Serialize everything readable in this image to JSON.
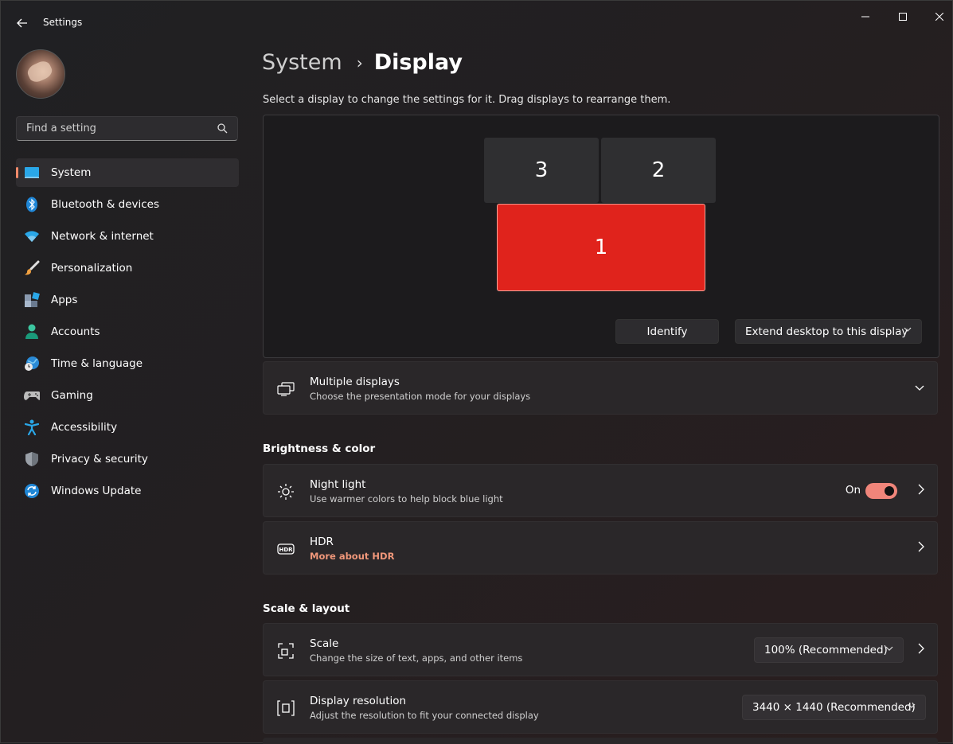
{
  "app": {
    "title": "Settings"
  },
  "search": {
    "placeholder": "Find a setting"
  },
  "sidebar": {
    "items": [
      {
        "label": "System"
      },
      {
        "label": "Bluetooth & devices"
      },
      {
        "label": "Network & internet"
      },
      {
        "label": "Personalization"
      },
      {
        "label": "Apps"
      },
      {
        "label": "Accounts"
      },
      {
        "label": "Time & language"
      },
      {
        "label": "Gaming"
      },
      {
        "label": "Accessibility"
      },
      {
        "label": "Privacy & security"
      },
      {
        "label": "Windows Update"
      }
    ]
  },
  "breadcrumb": {
    "parent": "System",
    "separator": "›",
    "current": "Display"
  },
  "main": {
    "subtitle": "Select a display to change the settings for it. Drag displays to rearrange them.",
    "monitors": {
      "m1": "1",
      "m2": "2",
      "m3": "3"
    },
    "identify_label": "Identify",
    "extend_label": "Extend desktop to this display",
    "multiple_displays": {
      "title": "Multiple displays",
      "desc": "Choose the presentation mode for your displays"
    },
    "brightness_section": "Brightness & color",
    "night_light": {
      "title": "Night light",
      "desc": "Use warmer colors to help block blue light",
      "state": "On"
    },
    "hdr": {
      "title": "HDR",
      "link": "More about HDR"
    },
    "scale_section": "Scale & layout",
    "scale": {
      "title": "Scale",
      "desc": "Change the size of text, apps, and other items",
      "value": "100% (Recommended)"
    },
    "resolution": {
      "title": "Display resolution",
      "desc": "Adjust the resolution to fit your connected display",
      "value": "3440 × 1440 (Recommended)"
    }
  },
  "colors": {
    "accent": "#f0857a",
    "selected_display": "#e0231c",
    "link": "#f0977a"
  }
}
